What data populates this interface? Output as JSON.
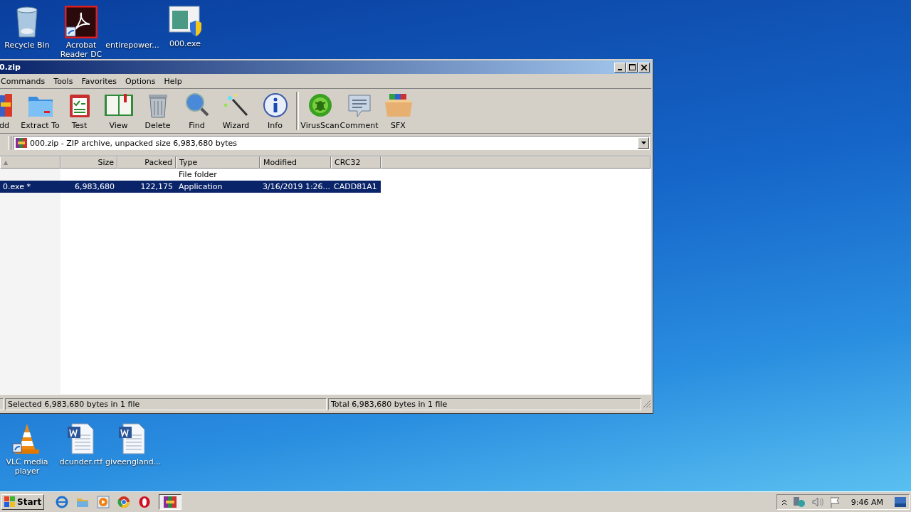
{
  "desktop_icons": [
    {
      "label": "Recycle Bin"
    },
    {
      "label": "Acrobat Reader DC"
    },
    {
      "label": "entirepower..."
    },
    {
      "label": "000.exe"
    },
    {
      "label": "VLC media player"
    },
    {
      "label": "dcunder.rtf"
    },
    {
      "label": "giveengland..."
    }
  ],
  "window": {
    "title": "0.zip"
  },
  "menu": [
    "Commands",
    "Tools",
    "Favorites",
    "Options",
    "Help"
  ],
  "toolbar": [
    {
      "label": "dd"
    },
    {
      "label": "Extract To"
    },
    {
      "label": "Test"
    },
    {
      "label": "View"
    },
    {
      "label": "Delete"
    },
    {
      "label": "Find"
    },
    {
      "label": "Wizard"
    },
    {
      "label": "Info"
    },
    {
      "label": "VirusScan"
    },
    {
      "label": "Comment"
    },
    {
      "label": "SFX"
    }
  ],
  "address_bar": {
    "value": "000.zip - ZIP archive, unpacked size 6,983,680 bytes"
  },
  "table": {
    "sort_mark": "▲",
    "columns": [
      "Size",
      "Packed",
      "Type",
      "Modified",
      "CRC32"
    ],
    "rows": [
      {
        "name": "",
        "size": "",
        "packed": "",
        "type": "File folder",
        "modified": "",
        "crc32": "",
        "selected": false
      },
      {
        "name": "0.exe *",
        "size": "6,983,680",
        "packed": "122,175",
        "type": "Application",
        "modified": "3/16/2019 1:26...",
        "crc32": "CADD81A1",
        "selected": true
      }
    ]
  },
  "status_bar": {
    "left": "Selected 6,983,680 bytes in 1 file",
    "right": "Total 6,983,680 bytes in 1 file"
  },
  "taskbar": {
    "start": "Start",
    "clock": "9:46 AM"
  }
}
